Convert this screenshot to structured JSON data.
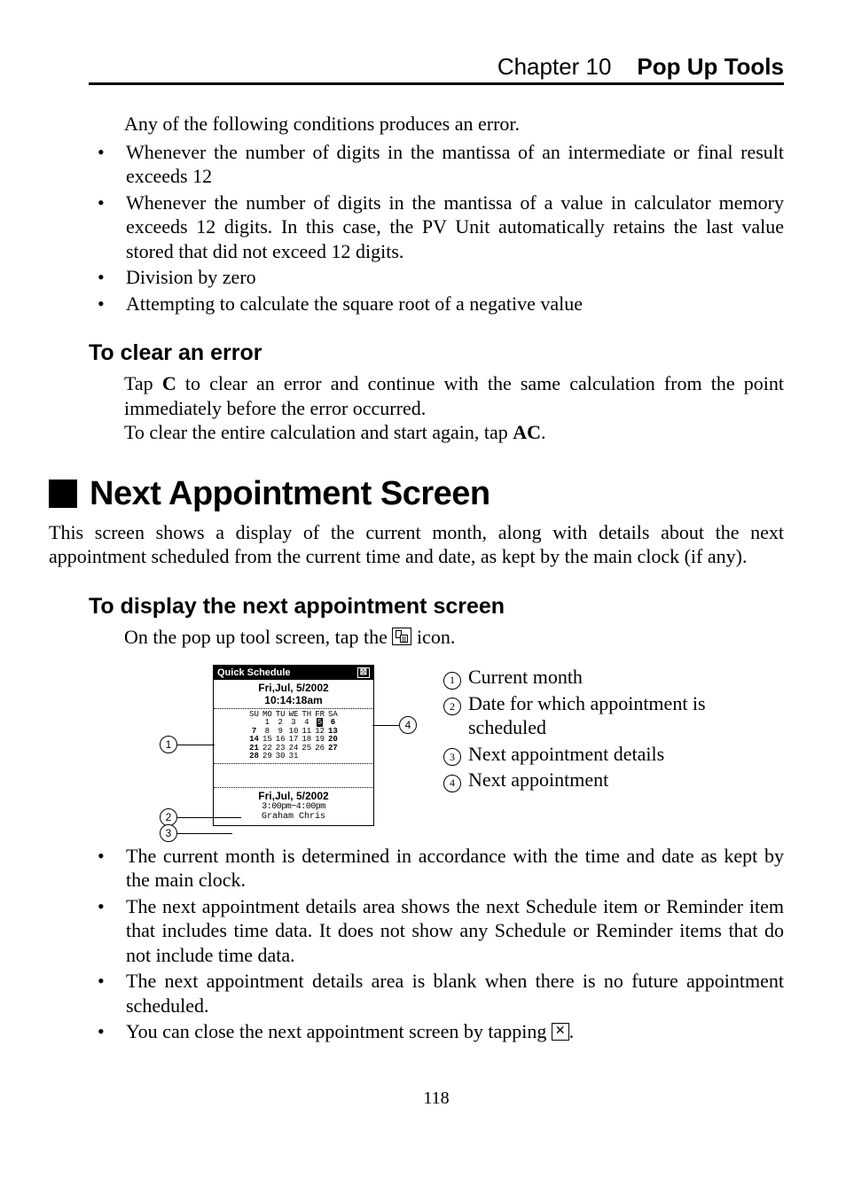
{
  "header": {
    "chapter_label": "Chapter 10",
    "chapter_title": "Pop Up Tools"
  },
  "errors": {
    "intro": "Any of the following conditions produces an error.",
    "items": [
      "Whenever the number of digits in the mantissa of an intermediate or final result exceeds 12",
      "Whenever the number of digits in the mantissa of a value in calculator memory exceeds 12 digits. In this case, the PV Unit automatically retains the last value stored that did not exceed 12 digits.",
      "Division by zero",
      "Attempting to calculate the square root of a negative value"
    ]
  },
  "clear_error": {
    "heading": "To clear an error",
    "line1_a": "Tap ",
    "line1_b": "C",
    "line1_c": " to clear an error and continue with the same calculation from the point immediately before the error occurred.",
    "line2_a": "To clear the entire calculation and start again, tap ",
    "line2_b": "AC",
    "line2_c": "."
  },
  "next_appt": {
    "heading": "Next Appointment Screen",
    "intro": "This screen shows a display of the current month, along with details about the next appointment scheduled from the current time and date, as kept by the main clock (if any).",
    "sub_heading": "To display the next appointment screen",
    "tap_a": "On the pop up tool screen, tap the ",
    "tap_b": " icon."
  },
  "screenshot": {
    "title": "Quick Schedule",
    "date_header": "Fri,Jul, 5/2002",
    "time_header": "10:14:18am",
    "days": {
      "d0": "SU",
      "d1": "MO",
      "d2": "TU",
      "d3": "WE",
      "d4": "TH",
      "d5": "FR",
      "d6": "SA"
    },
    "w1": {
      "c1": "1",
      "c2": "2",
      "c3": "3",
      "c4": "4",
      "c5": "5",
      "c6": "6"
    },
    "w2": {
      "c0": "7",
      "c1": "8",
      "c2": "9",
      "c3": "10",
      "c4": "11",
      "c5": "12",
      "c6": "13"
    },
    "w3": {
      "c0": "14",
      "c1": "15",
      "c2": "16",
      "c3": "17",
      "c4": "18",
      "c5": "19",
      "c6": "20"
    },
    "w4": {
      "c0": "21",
      "c1": "22",
      "c2": "23",
      "c3": "24",
      "c4": "25",
      "c5": "26",
      "c6": "27"
    },
    "w5": {
      "c0": "28",
      "c1": "29",
      "c2": "30",
      "c3": "31"
    },
    "appt_date": "Fri,Jul, 5/2002",
    "appt_time": "3:00pm~4:00pm",
    "appt_name": "Graham Chris"
  },
  "markers": {
    "m1": "1",
    "m2": "2",
    "m3": "3",
    "m4": "4"
  },
  "legend": {
    "l1": "Current month",
    "l2": "Date for which appointment is scheduled",
    "l3": "Next appointment details",
    "l4": "Next appointment"
  },
  "notes": {
    "n1": "The current month is determined in accordance with the time and date as kept by the main clock.",
    "n2": "The next appointment details area shows the next Schedule item or Reminder item that includes time data. It does not show any Schedule or Reminder items that do not include time data.",
    "n3": "The next appointment details area is blank when there is no future appointment scheduled.",
    "n4_a": "You can close the next appointment screen by tapping ",
    "n4_b": "."
  },
  "close_icon_glyph": "✕",
  "page_number": "118"
}
